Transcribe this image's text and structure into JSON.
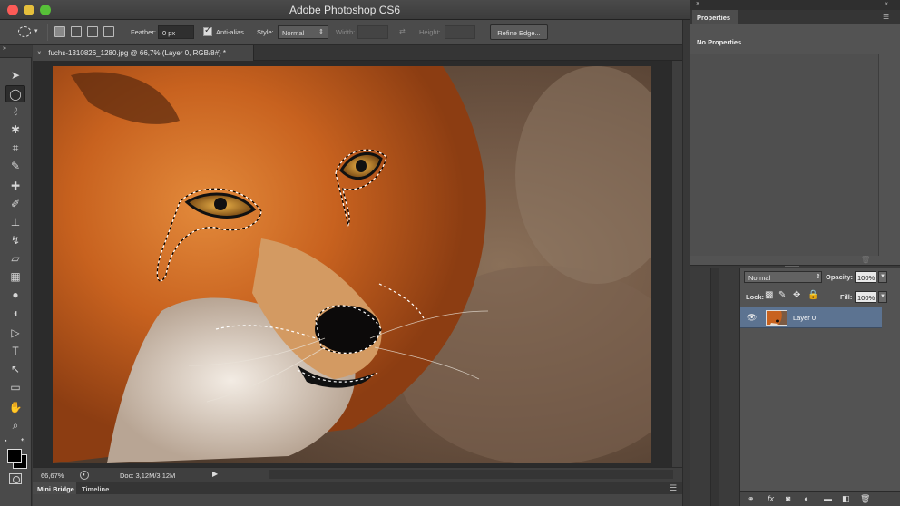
{
  "window": {
    "title": "Adobe Photoshop CS6"
  },
  "options_bar": {
    "feather_label": "Feather:",
    "feather_value": "0 px",
    "anti_alias_label": "Anti-alias",
    "style_label": "Style:",
    "style_value": "Normal",
    "width_label": "Width:",
    "height_label": "Height:",
    "refine_edge_label": "Refine Edge..."
  },
  "document_tab": {
    "close_glyph": "×",
    "title": "fuchs-1310826_1280.jpg @ 66,7% (Layer 0, RGB/8#) *"
  },
  "status_bar": {
    "zoom": "66,67%",
    "doc_info": "Doc: 3,12M/3,12M"
  },
  "bottom_tabs": {
    "mini_bridge": "Mini Bridge",
    "timeline": "Timeline"
  },
  "properties_panel": {
    "tab_label": "Properties",
    "empty_text": "No Properties"
  },
  "layers_panel": {
    "blend_mode": "Normal",
    "opacity_label": "Opacity:",
    "opacity_value": "100%",
    "lock_label": "Lock:",
    "fill_label": "Fill:",
    "fill_value": "100%",
    "layers": [
      {
        "name": "Layer 0",
        "visible": true,
        "selected": true
      }
    ]
  },
  "colors": {
    "selected_layer": "#5c7391",
    "foreground_color": "#000000",
    "background_color": "#000000"
  }
}
